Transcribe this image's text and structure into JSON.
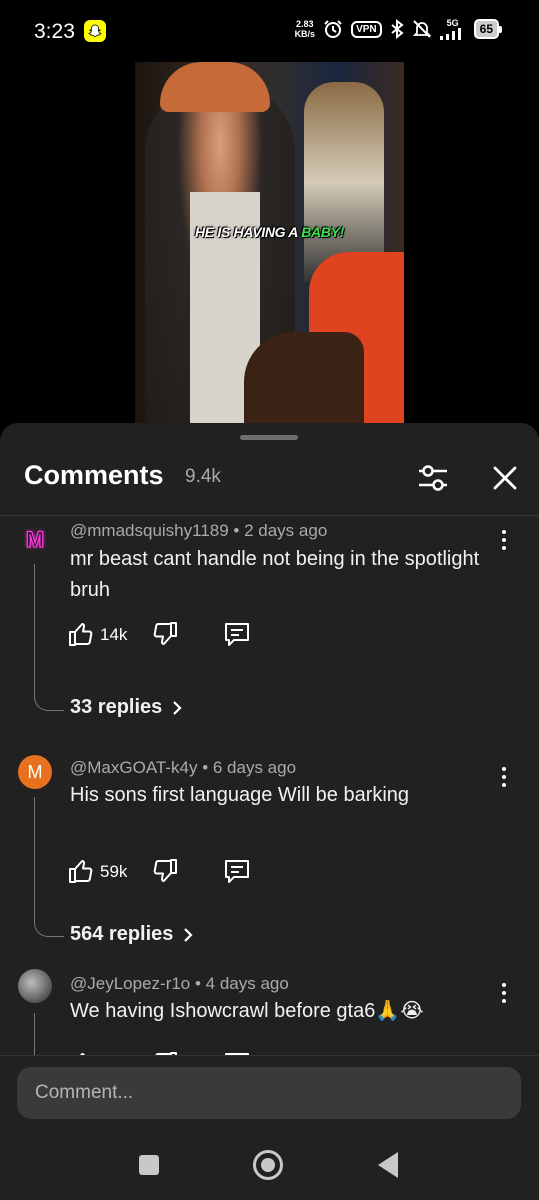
{
  "status_bar": {
    "time": "3:23",
    "net_speed_value": "2.83",
    "net_speed_unit": "KB/s",
    "vpn": "VPN",
    "network": "5G",
    "battery": "65"
  },
  "video": {
    "caption_pre": "HE IS HAVING A ",
    "caption_highlight": "BABY!"
  },
  "sheet": {
    "title": "Comments",
    "count": "9.4k"
  },
  "comments": [
    {
      "avatar_letter": "M",
      "avatar_color": "#1a0d2e",
      "handle": "@mmadsquishy1189",
      "age": "2 days ago",
      "text": "mr beast cant handle not being in the spotlight bruh",
      "likes": "14k",
      "replies": "33 replies"
    },
    {
      "avatar_letter": "M",
      "avatar_color": "#e8711f",
      "handle": "@MaxGOAT-k4y",
      "age": "6 days ago",
      "text": "His sons first language Will be barking",
      "likes": "59k",
      "replies": "564 replies"
    },
    {
      "avatar_letter": "",
      "avatar_color": "#6b6b6b",
      "handle": "@JeyLopez-r1o",
      "age": "4 days ago",
      "text": "We having Ishowcrawl before gta6🙏😭",
      "likes": "",
      "replies": ""
    }
  ],
  "input": {
    "placeholder": "Comment..."
  }
}
